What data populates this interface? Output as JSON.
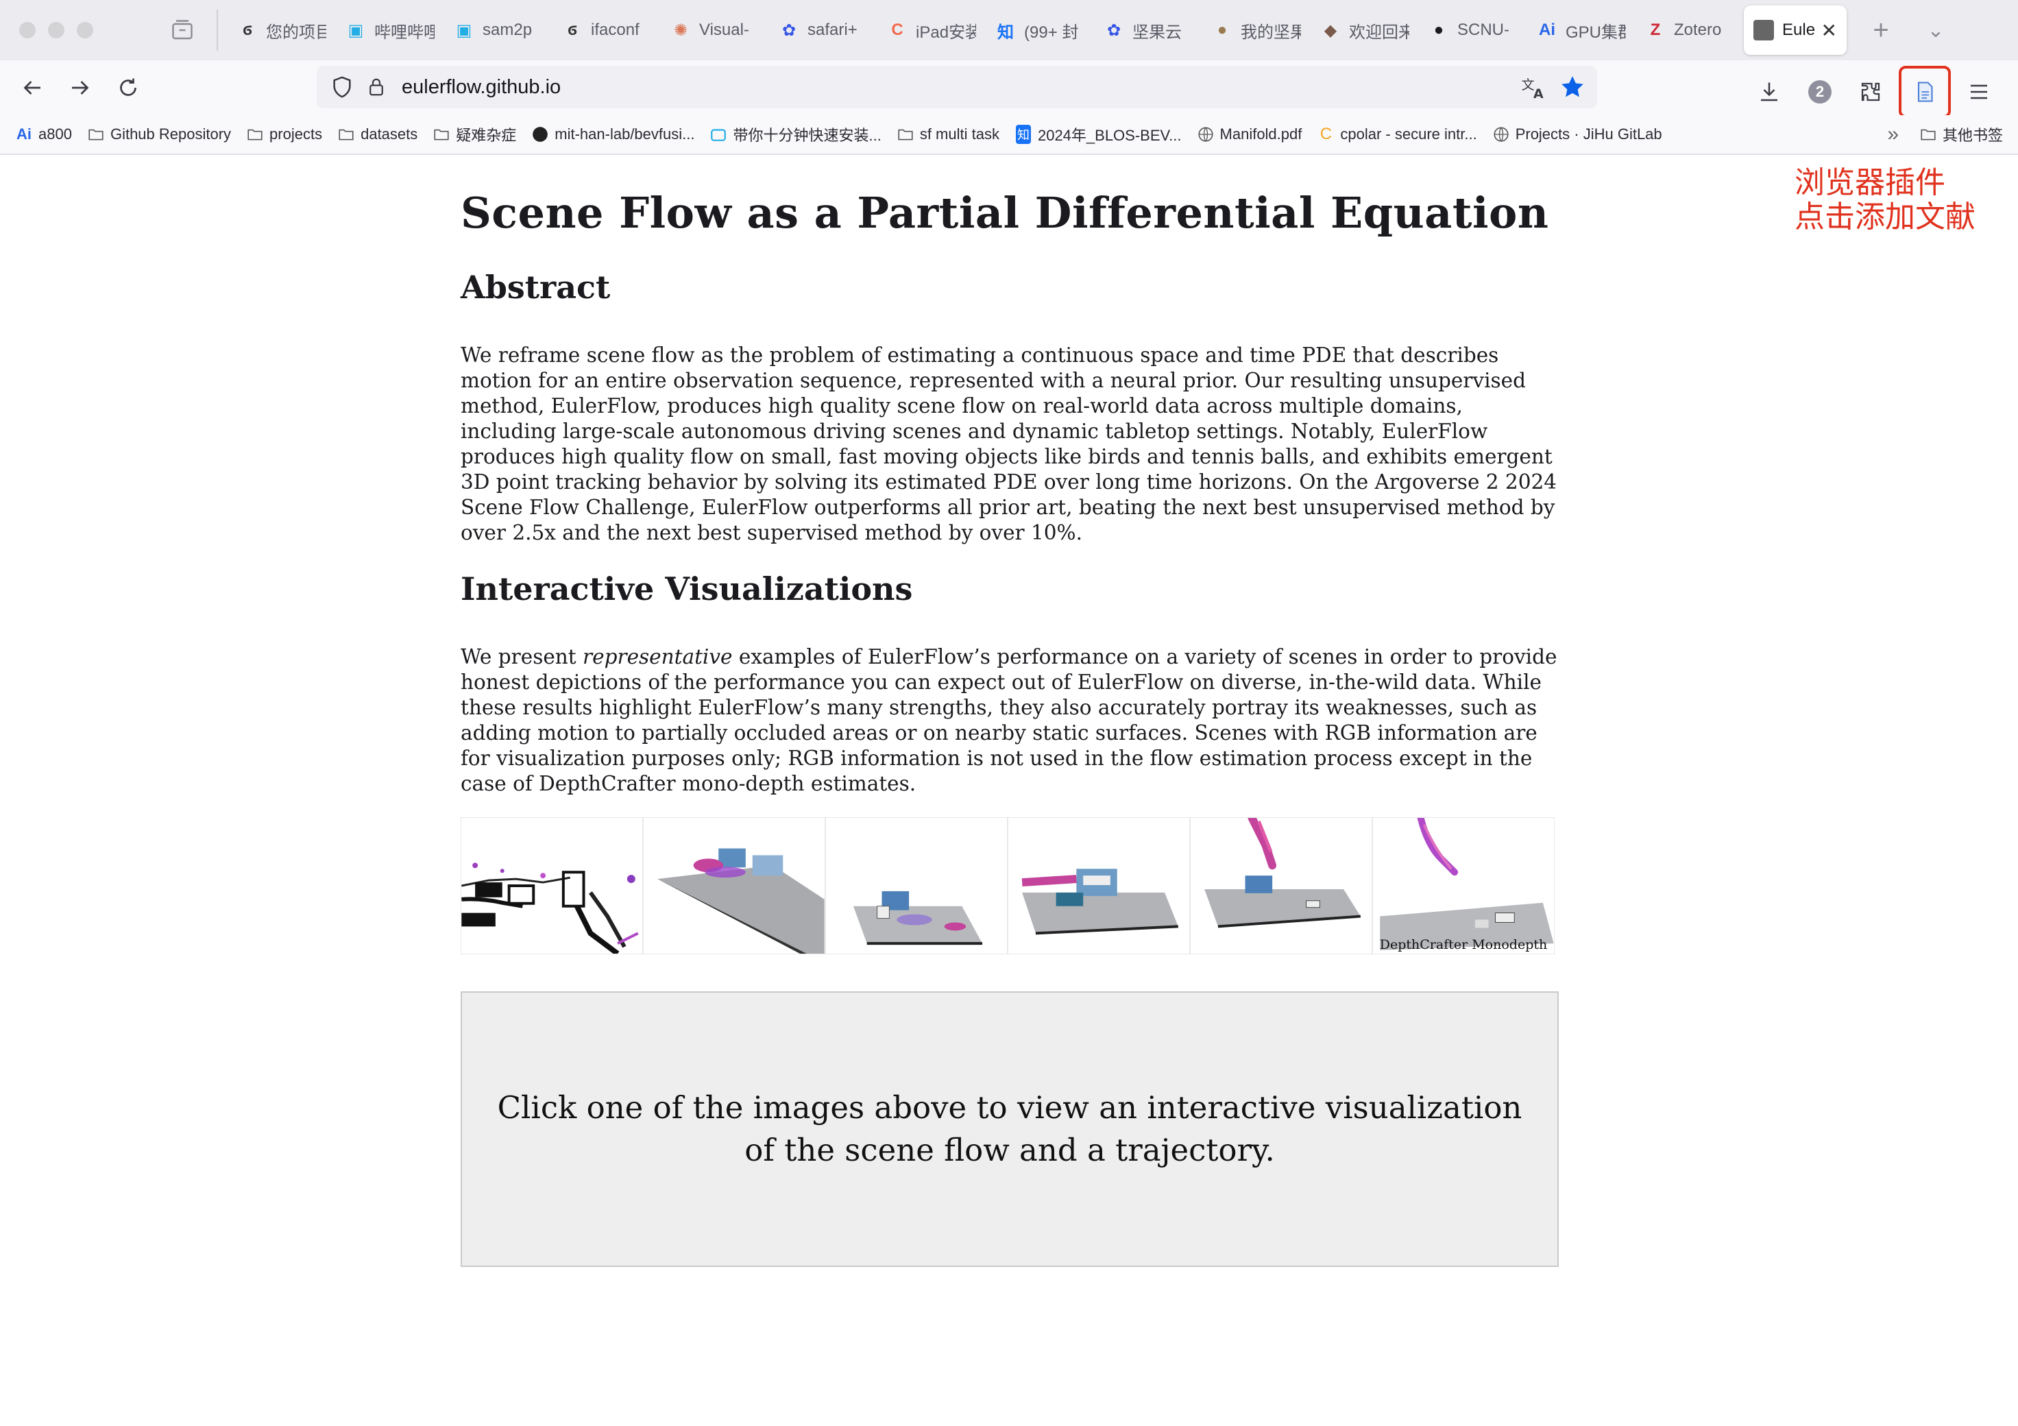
{
  "browser": {
    "tabs": [
      {
        "label": "您的项目",
        "icon": "openai-icon",
        "color": "#333333"
      },
      {
        "label": "哔哩哔哩",
        "icon": "bilibili-icon",
        "color": "#23ade5"
      },
      {
        "label": "sam2p",
        "icon": "bilibili-icon",
        "color": "#23ade5"
      },
      {
        "label": "ifaconf",
        "icon": "openai-icon",
        "color": "#333333"
      },
      {
        "label": "Visual-",
        "icon": "claude-icon",
        "color": "#d97757"
      },
      {
        "label": "safari+",
        "icon": "baidu-icon",
        "color": "#3857e6"
      },
      {
        "label": "iPad安装",
        "icon": "c-icon",
        "color": "#f26a4f"
      },
      {
        "label": "(99+ 封",
        "icon": "zhihu-icon",
        "color": "#1772f6"
      },
      {
        "label": "坚果云",
        "icon": "baidu-icon",
        "color": "#3857e6"
      },
      {
        "label": "我的坚果",
        "icon": "nut-icon",
        "color": "#9a7b4f"
      },
      {
        "label": "欢迎回来",
        "icon": "avatar-icon",
        "color": "#7a5a4a"
      },
      {
        "label": "SCNU-",
        "icon": "github-icon",
        "color": "#1b1b1f"
      },
      {
        "label": "GPU集群",
        "icon": "ai-icon",
        "color": "#2866e8"
      },
      {
        "label": "Zotero",
        "icon": "zotero-icon",
        "color": "#cc2936"
      }
    ],
    "active_tab": {
      "label": "Eule",
      "close": "✕"
    },
    "new_tab": "+",
    "url": "eulerflow.github.io",
    "downloads_badge": "2",
    "bookmarks": [
      {
        "label": "a800",
        "icon": "ai-icon"
      },
      {
        "label": "Github Repository",
        "icon": "folder-icon"
      },
      {
        "label": "projects",
        "icon": "folder-icon"
      },
      {
        "label": "datasets",
        "icon": "folder-icon"
      },
      {
        "label": "疑难杂症",
        "icon": "folder-icon"
      },
      {
        "label": "mit-han-lab/bevfusi...",
        "icon": "github-icon"
      },
      {
        "label": "带你十分钟快速安装...",
        "icon": "bilibili-icon"
      },
      {
        "label": "sf multi task",
        "icon": "folder-icon"
      },
      {
        "label": "2024年_BLOS-BEV...",
        "icon": "zhihu-icon"
      },
      {
        "label": "Manifold.pdf",
        "icon": "globe-icon"
      },
      {
        "label": "cpolar - secure intr...",
        "icon": "cpolar-icon"
      },
      {
        "label": "Projects · JiHu GitLab",
        "icon": "globe-icon"
      }
    ],
    "bookmarks_more": "»",
    "other_bookmarks": "其他书签"
  },
  "page": {
    "title": "Scene Flow as a Partial Differential Equation",
    "abstract_heading": "Abstract",
    "abstract_text": "We reframe scene flow as the problem of estimating a continuous space and time PDE that describes motion for an entire observation sequence, represented with a neural prior. Our resulting unsupervised method, EulerFlow, produces high quality scene flow on real-world data across multiple domains, including large-scale autonomous driving scenes and dynamic tabletop settings. Notably, EulerFlow produces high quality flow on small, fast moving objects like birds and tennis balls, and exhibits emergent 3D point tracking behavior by solving its estimated PDE over long time horizons. On the Argoverse 2 2024 Scene Flow Challenge, EulerFlow outperforms all prior art, beating the next best unsupervised method by over 2.5x and the next best supervised method by over 10%.",
    "viz_heading": "Interactive Visualizations",
    "viz_text_pre": "We present ",
    "viz_text_em": "representative",
    "viz_text_post": " examples of EulerFlow’s performance on a variety of scenes in order to provide honest depictions of the performance you can expect out of EulerFlow on diverse, in-the-wild data. While these results highlight EulerFlow’s many strengths, they also accurately portray its weaknesses, such as adding motion to partially occluded areas or on nearby static surfaces. Scenes with RGB information are for visualization purposes only; RGB information is not used in the flow estimation process except in the case of DepthCrafter mono-depth estimates.",
    "thumbnails": [
      {
        "name": "thumbnail-driving-scene",
        "caption": ""
      },
      {
        "name": "thumbnail-tabletop-1",
        "caption": ""
      },
      {
        "name": "thumbnail-tabletop-2",
        "caption": ""
      },
      {
        "name": "thumbnail-tabletop-3",
        "caption": ""
      },
      {
        "name": "thumbnail-tabletop-4",
        "caption": ""
      },
      {
        "name": "thumbnail-depthcrafter",
        "caption": "DepthCrafter Monodepth"
      }
    ],
    "viz_placeholder": "Click one of the images above to view an interactive visualization of the scene flow and a trajectory."
  },
  "annotation": {
    "line1": "浏览器插件",
    "line2": "点击添加文献",
    "color": "#e0321e"
  }
}
